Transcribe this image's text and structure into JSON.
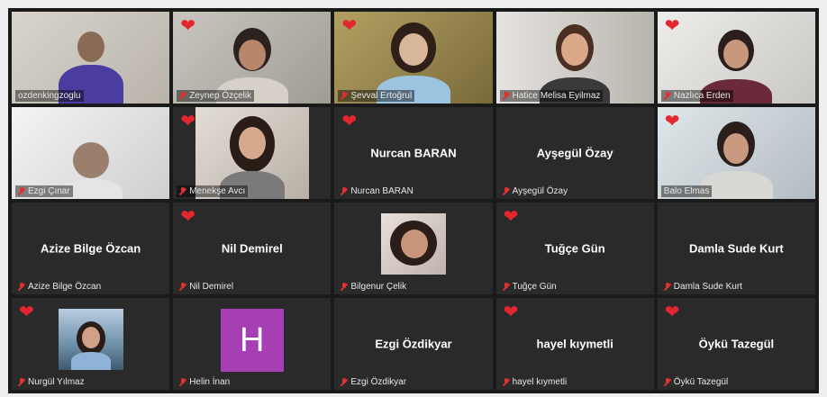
{
  "participants": [
    {
      "name": "ozdenkingzoglu",
      "type": "video",
      "active": true,
      "heart": false
    },
    {
      "name": "Zeynep Özçelik",
      "type": "video",
      "active": false,
      "heart": true
    },
    {
      "name": "Şevval Ertoğrul",
      "type": "video",
      "active": false,
      "heart": true
    },
    {
      "name": "Hatice Melisa Eyilmaz",
      "type": "video",
      "active": false,
      "heart": false
    },
    {
      "name": "Nazlıca Erden",
      "type": "video",
      "active": false,
      "heart": true
    },
    {
      "name": "Ezgi Çınar",
      "type": "video",
      "active": false,
      "heart": false
    },
    {
      "name": "Menekşe Avcı",
      "type": "video",
      "active": false,
      "heart": true
    },
    {
      "name": "Nurcan BARAN",
      "center": "Nurcan BARAN",
      "type": "name",
      "active": false,
      "heart": true
    },
    {
      "name": "Ayşegül Özay",
      "center": "Ayşegül Özay",
      "type": "name",
      "active": false,
      "heart": false
    },
    {
      "name": "Balo Elmas",
      "type": "video",
      "active": false,
      "heart": true
    },
    {
      "name": "Azize Bilge Özcan",
      "center": "Azize Bilge Özcan",
      "type": "name",
      "active": false,
      "heart": false
    },
    {
      "name": "Nil Demirel",
      "center": "Nil Demirel",
      "type": "name",
      "active": false,
      "heart": true
    },
    {
      "name": "Bilgenur Çelik",
      "type": "photo",
      "active": false,
      "heart": false
    },
    {
      "name": "Tuğçe Gün",
      "center": "Tuğçe Gün",
      "type": "name",
      "active": false,
      "heart": true
    },
    {
      "name": "Damla Sude Kurt",
      "center": "Damla Sude Kurt",
      "type": "name",
      "active": false,
      "heart": false
    },
    {
      "name": "Nurgül Yılmaz",
      "type": "photo",
      "active": false,
      "heart": true
    },
    {
      "name": "Helin İnan",
      "type": "avatar",
      "avatar_letter": "H",
      "active": false,
      "heart": false
    },
    {
      "name": "Ezgi Özdikyar",
      "center": "Ezgi Özdikyar",
      "type": "name",
      "active": false,
      "heart": false
    },
    {
      "name": "hayel kıymetli",
      "center": "hayel kıymetli",
      "type": "name",
      "active": false,
      "heart": true
    },
    {
      "name": "Öykü Tazegül",
      "center": "Öykü Tazegül",
      "type": "name",
      "active": false,
      "heart": true
    }
  ],
  "colors": {
    "active_border": "#b5d334",
    "heart": "#e3262f",
    "muted_mic": "#e03030",
    "avatar_bg": "#a63fb4",
    "tile_bg": "#2a2a2a"
  },
  "icons": {
    "heart": "heart-reaction-icon",
    "mic": "muted-mic-icon"
  }
}
